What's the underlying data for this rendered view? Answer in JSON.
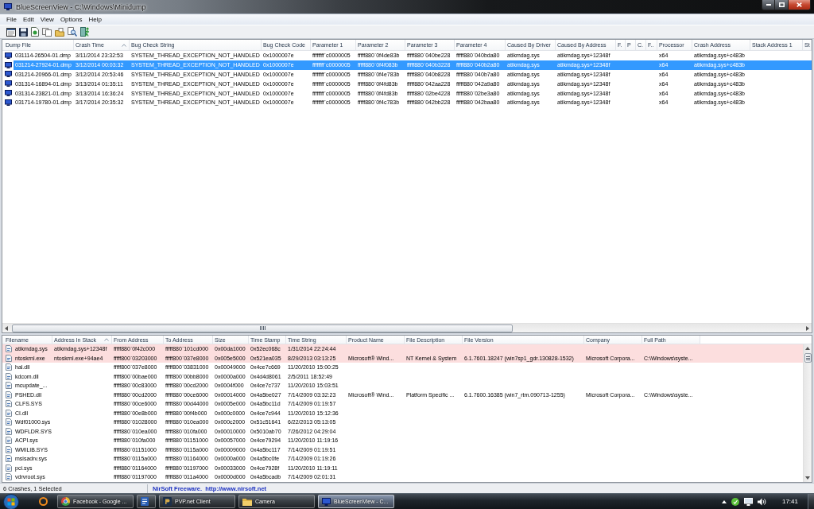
{
  "window": {
    "title": "BlueScreenView - C:\\Windows\\Minidump"
  },
  "menu": [
    "File",
    "Edit",
    "View",
    "Options",
    "Help"
  ],
  "crash_list": {
    "columns": [
      {
        "label": "Dump File",
        "sorted": false
      },
      {
        "label": "Crash Time",
        "sorted": true
      },
      {
        "label": "Bug Check String",
        "sorted": false
      },
      {
        "label": "Bug Check Code",
        "sorted": false
      },
      {
        "label": "Parameter 1",
        "sorted": false
      },
      {
        "label": "Parameter 2",
        "sorted": false
      },
      {
        "label": "Parameter 3",
        "sorted": false
      },
      {
        "label": "Parameter 4",
        "sorted": false
      },
      {
        "label": "Caused By Driver",
        "sorted": false
      },
      {
        "label": "Caused By Address",
        "sorted": false
      },
      {
        "label": "F.",
        "sorted": false
      },
      {
        "label": "P",
        "sorted": false
      },
      {
        "label": "C.",
        "sorted": false
      },
      {
        "label": "F..",
        "sorted": false
      },
      {
        "label": "Processor",
        "sorted": false
      },
      {
        "label": "Crash Address",
        "sorted": false
      },
      {
        "label": "Stack Address 1",
        "sorted": false
      },
      {
        "label": "St",
        "sorted": false
      }
    ],
    "rows": [
      {
        "selected": false,
        "cells": [
          "031114-26504-01.dmp",
          "3/11/2014 23:32:53",
          "SYSTEM_THREAD_EXCEPTION_NOT_HANDLED",
          "0x1000007e",
          "ffffffff`c0000005",
          "fffff880`0f4de83b",
          "fffff880`040be228",
          "fffff880`040bda80",
          "atikmdag.sys",
          "atikmdag.sys+12348f",
          null,
          null,
          null,
          null,
          "x64",
          "atikmdag.sys+c483b"
        ]
      },
      {
        "selected": true,
        "cells": [
          "031214-27924-01.dmp",
          "3/12/2014 00:03:32",
          "SYSTEM_THREAD_EXCEPTION_NOT_HANDLED",
          "0x1000007e",
          "ffffffff`c0000005",
          "fffff880`0f4f083b",
          "fffff880`040b3228",
          "fffff880`040b2a80",
          "atikmdag.sys",
          "atikmdag.sys+12348f",
          null,
          null,
          null,
          null,
          "x64",
          "atikmdag.sys+c483b"
        ]
      },
      {
        "selected": false,
        "cells": [
          "031214-20966-01.dmp",
          "3/12/2014 20:53:46",
          "SYSTEM_THREAD_EXCEPTION_NOT_HANDLED",
          "0x1000007e",
          "ffffffff`c0000005",
          "fffff880`0f4e783b",
          "fffff880`040b8228",
          "fffff880`040b7a80",
          "atikmdag.sys",
          "atikmdag.sys+12348f",
          null,
          null,
          null,
          null,
          "x64",
          "atikmdag.sys+c483b"
        ]
      },
      {
        "selected": false,
        "cells": [
          "031314-16894-01.dmp",
          "3/13/2014 01:35:11",
          "SYSTEM_THREAD_EXCEPTION_NOT_HANDLED",
          "0x1000007e",
          "ffffffff`c0000005",
          "fffff880`0f4fd83b",
          "fffff880`042aa228",
          "fffff880`042a9a80",
          "atikmdag.sys",
          "atikmdag.sys+12348f",
          null,
          null,
          null,
          null,
          "x64",
          "atikmdag.sys+c483b"
        ]
      },
      {
        "selected": false,
        "cells": [
          "031314-23821-01.dmp",
          "3/13/2014 16:36:24",
          "SYSTEM_THREAD_EXCEPTION_NOT_HANDLED",
          "0x1000007e",
          "ffffffff`c0000005",
          "fffff880`0f4fd83b",
          "fffff880`02be4228",
          "fffff880`02be3a80",
          "atikmdag.sys",
          "atikmdag.sys+12348f",
          null,
          null,
          null,
          null,
          "x64",
          "atikmdag.sys+c483b"
        ]
      },
      {
        "selected": false,
        "cells": [
          "031714-19780-01.dmp",
          "3/17/2014 20:35:32",
          "SYSTEM_THREAD_EXCEPTION_NOT_HANDLED",
          "0x1000007e",
          "ffffffff`c0000005",
          "fffff880`0f4c783b",
          "fffff880`042bb228",
          "fffff880`042baa80",
          "atikmdag.sys",
          "atikmdag.sys+12348f",
          null,
          null,
          null,
          null,
          "x64",
          "atikmdag.sys+c483b"
        ]
      }
    ]
  },
  "module_list": {
    "columns": [
      {
        "label": "Filename",
        "sorted": false
      },
      {
        "label": "Address In Stack",
        "sorted": true
      },
      {
        "label": "From Address",
        "sorted": false
      },
      {
        "label": "To Address",
        "sorted": false
      },
      {
        "label": "Size",
        "sorted": false
      },
      {
        "label": "Time Stamp",
        "sorted": false
      },
      {
        "label": "Time String",
        "sorted": false
      },
      {
        "label": "Product Name",
        "sorted": false
      },
      {
        "label": "File Description",
        "sorted": false
      },
      {
        "label": "File Version",
        "sorted": false
      },
      {
        "label": "Company",
        "sorted": false
      },
      {
        "label": "Full Path",
        "sorted": false
      }
    ],
    "rows": [
      {
        "highlighted": true,
        "cells": [
          "atikmdag.sys",
          "atikmdag.sys+12348f",
          "fffff880`0f42c000",
          "fffff880`101cd000",
          "0x00da1000",
          "0x52ec068c",
          "1/31/2014 22:24:44"
        ]
      },
      {
        "highlighted": true,
        "cells": [
          "ntoskrnl.exe",
          "ntoskrnl.exe+94ae4",
          "fffff800`03203000",
          "fffff800`037e8000",
          "0x005e5000",
          "0x521ea035",
          "8/29/2013 03:13:25",
          "Microsoft® Wind...",
          "NT Kernel & System",
          "6.1.7601.18247 (win7sp1_gdr.130828-1532)",
          "Microsoft Corpora...",
          "C:\\Windows\\syste..."
        ]
      },
      {
        "highlighted": false,
        "cells": [
          "hal.dll",
          null,
          "fffff800`037e8000",
          "fffff800`03831000",
          "0x00049000",
          "0x4ce7c669",
          "11/20/2010 15:00:25"
        ]
      },
      {
        "highlighted": false,
        "cells": [
          "kdcom.dll",
          null,
          "fffff800`00bae000",
          "fffff800`00bb8000",
          "0x0000a000",
          "0x4d4d8061",
          "2/5/2011 18:52:49"
        ]
      },
      {
        "highlighted": false,
        "cells": [
          "mcupdate_...",
          null,
          "fffff880`00c83000",
          "fffff880`00cd2000",
          "0x0004f000",
          "0x4ce7c737",
          "11/20/2010 15:03:51"
        ]
      },
      {
        "highlighted": false,
        "cells": [
          "PSHED.dll",
          null,
          "fffff880`00cd2000",
          "fffff880`00ce6000",
          "0x00014000",
          "0x4a5be027",
          "7/14/2009 03:32:23",
          "Microsoft® Wind...",
          "Platform Specific ...",
          "6.1.7600.16385 (win7_rtm.090713-1255)",
          "Microsoft Corpora...",
          "C:\\Windows\\syste..."
        ]
      },
      {
        "highlighted": false,
        "cells": [
          "CLFS.SYS",
          null,
          "fffff880`00ce6000",
          "fffff880`00d44000",
          "0x0005e000",
          "0x4a5bc11d",
          "7/14/2009 01:19:57"
        ]
      },
      {
        "highlighted": false,
        "cells": [
          "CI.dll",
          null,
          "fffff880`00e8b000",
          "fffff880`00f4b000",
          "0x000c0000",
          "0x4ce7c944",
          "11/20/2010 15:12:36"
        ]
      },
      {
        "highlighted": false,
        "cells": [
          "Wdf01000.sys",
          null,
          "fffff880`01028000",
          "fffff880`010ea000",
          "0x000c2000",
          "0x51c51641",
          "6/22/2013 05:13:05"
        ]
      },
      {
        "highlighted": false,
        "cells": [
          "WDFLDR.SYS",
          null,
          "fffff880`010ea000",
          "fffff880`010fa000",
          "0x00010000",
          "0x5010ab70",
          "7/26/2012 04:29:04"
        ]
      },
      {
        "highlighted": false,
        "cells": [
          "ACPI.sys",
          null,
          "fffff880`010fa000",
          "fffff880`01151000",
          "0x00057000",
          "0x4ce79294",
          "11/20/2010 11:19:16"
        ]
      },
      {
        "highlighted": false,
        "cells": [
          "WMILIB.SYS",
          null,
          "fffff880`01151000",
          "fffff880`0115a000",
          "0x00009000",
          "0x4a5bc117",
          "7/14/2009 01:19:51"
        ]
      },
      {
        "highlighted": false,
        "cells": [
          "msisadrv.sys",
          null,
          "fffff880`0115a000",
          "fffff880`01164000",
          "0x0000a000",
          "0x4a5bc0fe",
          "7/14/2009 01:19:26"
        ]
      },
      {
        "highlighted": false,
        "cells": [
          "pci.sys",
          null,
          "fffff880`01164000",
          "fffff880`01197000",
          "0x00033000",
          "0x4ce7928f",
          "11/20/2010 11:19:11"
        ]
      },
      {
        "highlighted": false,
        "cells": [
          "vdrvroot.sys",
          null,
          "fffff880`01197000",
          "fffff880`011a4000",
          "0x0000d000",
          "0x4a5bcadb",
          "7/14/2009 02:01:31"
        ]
      }
    ]
  },
  "status_bar": {
    "summary": "6 Crashes, 1 Selected",
    "link": "NirSoft Freeware.  http://www.nirsoft.net"
  },
  "taskbar": {
    "buttons": [
      {
        "kind": "ring",
        "running": false,
        "active": false
      },
      {
        "kind": "browser",
        "label": "Facebook - Google ...",
        "running": true,
        "active": false
      },
      {
        "kind": "document",
        "running": true,
        "active": false
      },
      {
        "kind": "game",
        "label": "PVP.net Client",
        "running": true,
        "active": false
      },
      {
        "kind": "folder",
        "label": "Camera",
        "running": true,
        "active": false
      },
      {
        "kind": "monitor",
        "label": "BlueScreenView - C...",
        "running": true,
        "active": true
      }
    ],
    "clock": "17:41"
  }
}
